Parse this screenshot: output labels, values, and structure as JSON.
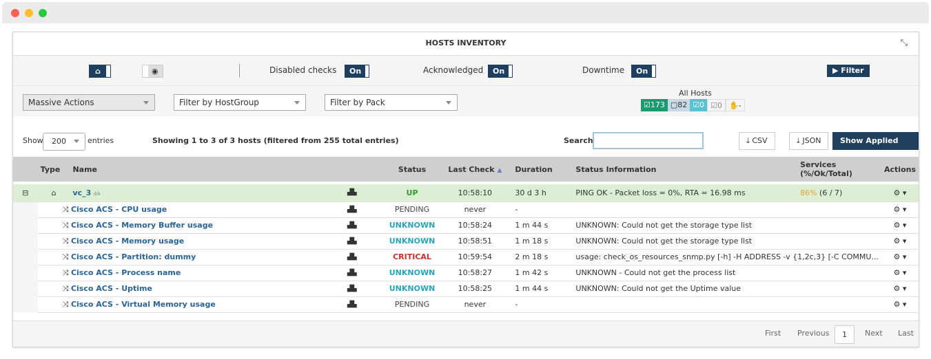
{
  "window": {
    "dots": [
      "#fe5f57",
      "#febc2e",
      "#28c840"
    ]
  },
  "title": "HOSTS INVENTORY",
  "toolbar": {
    "disabled_checks": "Disabled checks",
    "acknowledged": "Acknowledged",
    "downtime": "Downtime",
    "on": "On",
    "filter": "Filter"
  },
  "filters": {
    "massive": "Massive Actions",
    "hostgroup": "Filter by HostGroup",
    "pack": "Filter by Pack"
  },
  "all_hosts": {
    "label": "All Hosts",
    "badges": [
      "☑173",
      "▢82",
      "☑0",
      "☑0",
      "✋-"
    ]
  },
  "table_controls": {
    "show": "Show",
    "entries_value": "200",
    "entries": "entries",
    "info": "Showing 1 to 3 of 3 hosts (filtered from 255 total entries)",
    "search": "Search:",
    "csv": "CSV",
    "json": "JSON",
    "applied": "Show Applied Filters"
  },
  "columns": [
    "Type",
    "Name",
    "Status",
    "Last Check",
    "Duration",
    "Status Information",
    "Services (%/Ok/Total)",
    "Actions"
  ],
  "host": {
    "name": "vc_3",
    "status": "UP",
    "last": "10:58:10",
    "duration": "30 d 3 h",
    "info": "PING OK - Packet loss = 0%, RTA = 16.98 ms",
    "pct": "86%",
    "count": "(6 / 7)"
  },
  "services": [
    {
      "name": "Cisco ACS - CPU usage",
      "status": "PENDING",
      "last": "never",
      "duration": "-",
      "info": ""
    },
    {
      "name": "Cisco ACS - Memory Buffer usage",
      "status": "UNKNOWN",
      "last": "10:58:24",
      "duration": "1 m 44 s",
      "info": "UNKNOWN: Could not get the storage type list"
    },
    {
      "name": "Cisco ACS - Memory usage",
      "status": "UNKNOWN",
      "last": "10:58:51",
      "duration": "1 m 18 s",
      "info": "UNKNOWN: Could not get the storage type list"
    },
    {
      "name": "Cisco ACS - Partition: dummy",
      "status": "CRITICAL",
      "last": "10:59:54",
      "duration": "2 m 18 s",
      "info": "usage: check_os_resources_snmp.py [-h] -H ADDRESS -v {1,2c,3} [-C COMMU..."
    },
    {
      "name": "Cisco ACS - Process name",
      "status": "UNKNOWN",
      "last": "10:58:27",
      "duration": "1 m 42 s",
      "info": "UNKNOWN - Could not get the process list"
    },
    {
      "name": "Cisco ACS - Uptime",
      "status": "UNKNOWN",
      "last": "10:58:25",
      "duration": "1 m 44 s",
      "info": "UNKNOWN: Could not get the Uptime value"
    },
    {
      "name": "Cisco ACS - Virtual Memory usage",
      "status": "PENDING",
      "last": "never",
      "duration": "-",
      "info": ""
    }
  ],
  "status_colors": {
    "UP": "#2e9a2e",
    "PENDING": "#444444",
    "UNKNOWN": "#2aa5b8",
    "CRITICAL": "#c9302c"
  },
  "pagination": {
    "first": "First",
    "previous": "Previous",
    "page": "1",
    "next": "Next",
    "last": "Last"
  }
}
